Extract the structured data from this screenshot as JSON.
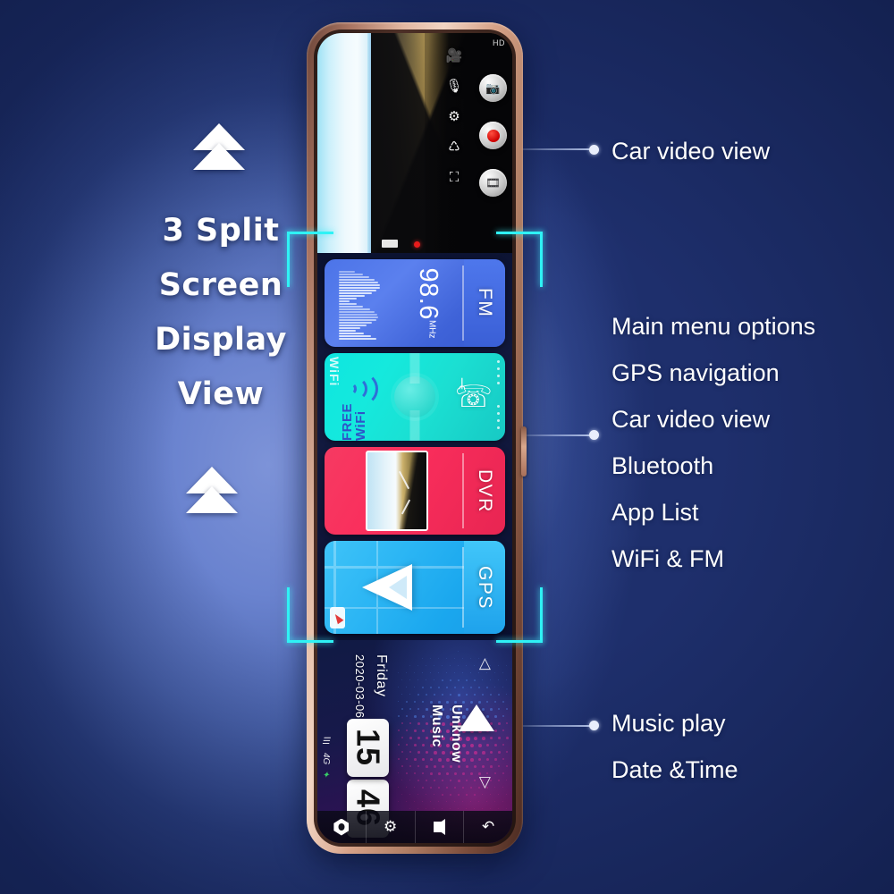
{
  "headline": {
    "lines": [
      "3 Split",
      "Screen",
      "Display",
      "View"
    ]
  },
  "callouts": {
    "top": {
      "lines": [
        "Car video view"
      ]
    },
    "middle": {
      "lines": [
        "Main menu options",
        "GPS navigation",
        "Car video view",
        "Bluetooth",
        "App List",
        "WiFi & FM"
      ]
    },
    "bottom": {
      "lines": [
        "Music play",
        "Date &Time"
      ]
    }
  },
  "device": {
    "camera_view": {
      "icons": [
        "video-icon",
        "mic-icon",
        "gear-icon",
        "rotate-icon",
        "bracket-icon"
      ],
      "buttons": [
        "photo-capture",
        "record",
        "gallery"
      ],
      "corner_label": "HD"
    },
    "tiles": [
      {
        "name": "fm",
        "label": "FM",
        "frequency": "98.6",
        "unit": "MHz"
      },
      {
        "name": "wifi-bluetooth",
        "label": "WiFi",
        "wifi_text": "FREE WiFi",
        "bt_glyph": "ᛦ"
      },
      {
        "name": "dvr",
        "label": "DVR"
      },
      {
        "name": "gps",
        "label": "GPS"
      }
    ],
    "music": {
      "date": "2020-03-06",
      "day": "Friday",
      "hour": "15",
      "minute": "46",
      "track_title": "Music",
      "track_artist": "Unknow",
      "network": "4G"
    },
    "navbar": [
      "home-button",
      "settings-button",
      "back-button",
      "return-button"
    ]
  },
  "colors": {
    "background_dark": "#1b2d66",
    "background_glow": "#6b86d0",
    "bracket": "#2ff2f5",
    "fm_tile": "#4c74e8",
    "wifi_tile": "#0ee6e0",
    "dvr_tile": "#fa2e5c",
    "gps_tile": "#2cb6f4",
    "bezel": "#e2b8a2",
    "record_red": "#cc0000",
    "text_white": "#ffffff"
  }
}
